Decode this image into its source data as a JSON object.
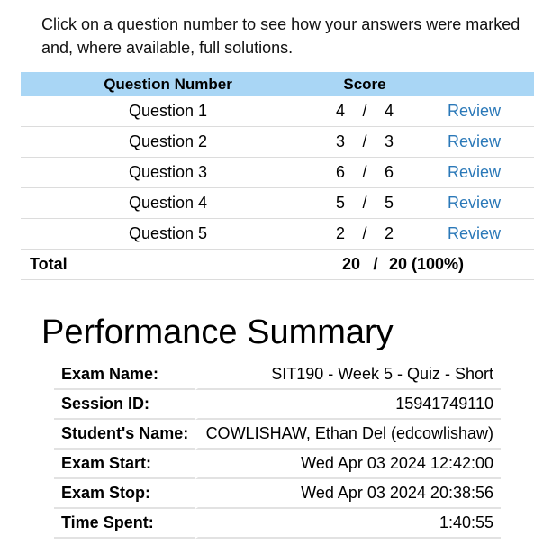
{
  "intro_text": "Click on a question number to see how your answers were marked and, where available, full solutions.",
  "table": {
    "headers": {
      "question": "Question Number",
      "score": "Score"
    },
    "rows": [
      {
        "question": "Question 1",
        "score": "4",
        "max": "4",
        "action": "Review"
      },
      {
        "question": "Question 2",
        "score": "3",
        "max": "3",
        "action": "Review"
      },
      {
        "question": "Question 3",
        "score": "6",
        "max": "6",
        "action": "Review"
      },
      {
        "question": "Question 4",
        "score": "5",
        "max": "5",
        "action": "Review"
      },
      {
        "question": "Question 5",
        "score": "2",
        "max": "2",
        "action": "Review"
      }
    ],
    "separator": "/",
    "total": {
      "label": "Total",
      "score": "20",
      "max": "20 (100%)"
    }
  },
  "performance_summary": {
    "title": "Performance Summary",
    "rows": [
      {
        "label": "Exam Name:",
        "value": "SIT190 - Week 5 - Quiz - Short"
      },
      {
        "label": "Session ID:",
        "value": "15941749110"
      },
      {
        "label": "Student's Name:",
        "value": "COWLISHAW, Ethan Del (edcowlishaw)"
      },
      {
        "label": "Exam Start:",
        "value": "Wed Apr 03 2024 12:42:00"
      },
      {
        "label": "Exam Stop:",
        "value": "Wed Apr 03 2024 20:38:56"
      },
      {
        "label": "Time Spent:",
        "value": "1:40:55"
      }
    ]
  },
  "colors": {
    "header_bg": "#a9d6f5",
    "link": "#2a78b8",
    "row_border": "#dcdcdc"
  }
}
